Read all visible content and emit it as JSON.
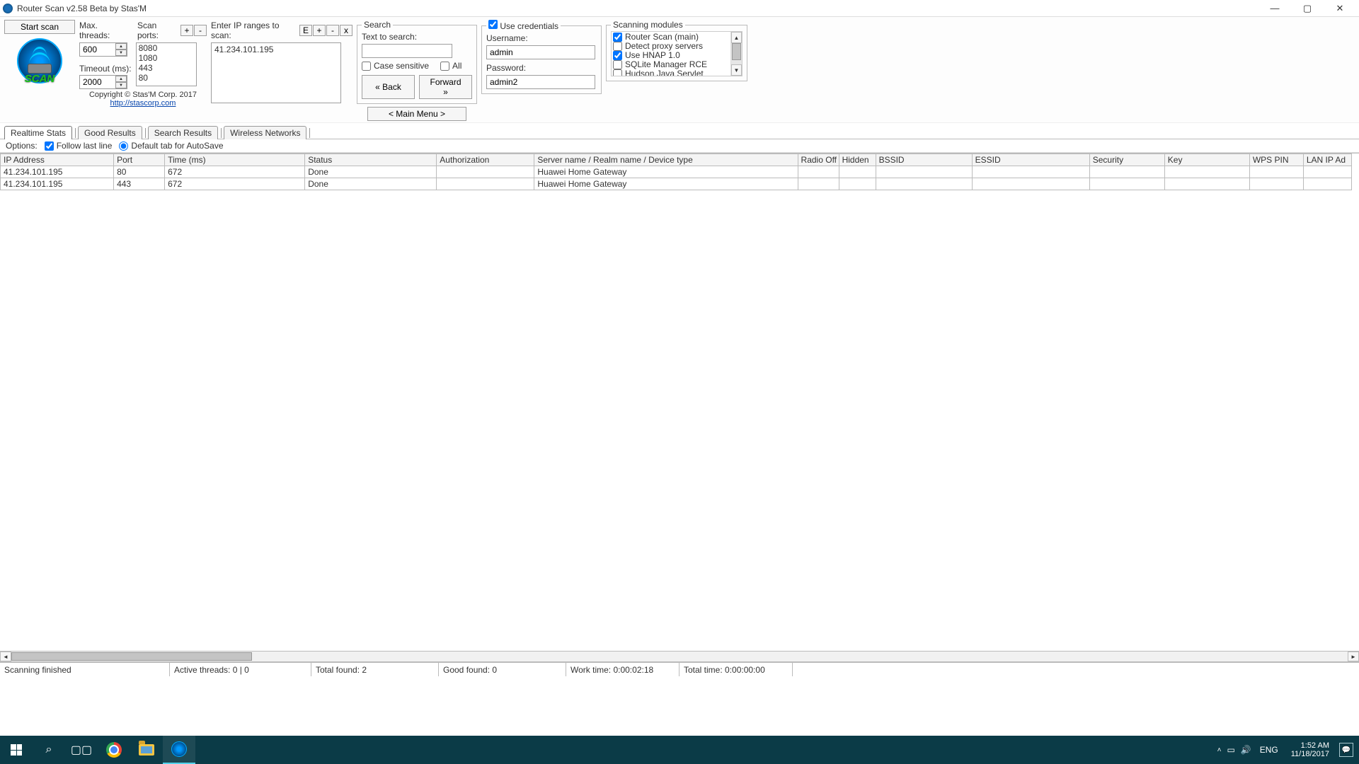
{
  "window": {
    "title": "Router Scan v2.58 Beta by Stas'M",
    "min": "—",
    "max": "▢",
    "close": "✕"
  },
  "buttons": {
    "start_scan": "Start scan",
    "plus": "+",
    "minus": "-",
    "E": "E",
    "x": "x",
    "back": "« Back",
    "forward": "Forward »",
    "main_menu": "< Main Menu >"
  },
  "threads": {
    "max_label": "Max. threads:",
    "scan_ports_label": "Scan ports:",
    "max_value": "600",
    "timeout_label": "Timeout (ms):",
    "timeout_value": "2000",
    "ports": [
      "8080",
      "1080",
      "443",
      "80"
    ]
  },
  "ip": {
    "enter_label": "Enter IP ranges to scan:",
    "value": "41.234.101.195"
  },
  "copyright": {
    "text": "Copyright © Stas'M Corp. 2017",
    "link": "http://stascorp.com"
  },
  "search": {
    "legend": "Search",
    "text_label": "Text to search:",
    "value": "",
    "case_sensitive": "Case sensitive",
    "all": "All",
    "case_checked": false,
    "all_checked": false
  },
  "creds": {
    "use_label": "Use credentials",
    "use_checked": true,
    "user_label": "Username:",
    "user_value": "admin",
    "pass_label": "Password:",
    "pass_value": "admin2"
  },
  "modules": {
    "legend": "Scanning modules",
    "items": [
      {
        "label": "Router Scan (main)",
        "checked": true
      },
      {
        "label": "Detect proxy servers",
        "checked": false
      },
      {
        "label": "Use HNAP 1.0",
        "checked": true
      },
      {
        "label": "SQLite Manager RCE",
        "checked": false
      },
      {
        "label": "Hudson Java Servlet",
        "checked": false
      }
    ]
  },
  "tabs": [
    "Realtime Stats",
    "Good Results",
    "Search Results",
    "Wireless Networks"
  ],
  "options": {
    "label": "Options:",
    "follow_label": "Follow last line",
    "follow_checked": true,
    "default_tab_label": "Default tab for AutoSave",
    "default_tab_selected": true
  },
  "table": {
    "columns": [
      "IP Address",
      "Port",
      "Time (ms)",
      "Status",
      "Authorization",
      "Server name / Realm name / Device type",
      "Radio Off",
      "Hidden",
      "BSSID",
      "ESSID",
      "Security",
      "Key",
      "WPS PIN",
      "LAN IP Ad"
    ],
    "widths": [
      160,
      72,
      198,
      186,
      138,
      372,
      58,
      52,
      136,
      166,
      106,
      120,
      76,
      68
    ],
    "rows": [
      {
        "ip": "41.234.101.195",
        "port": "80",
        "time": "672",
        "status": "Done",
        "auth": "",
        "server": "Huawei Home Gateway",
        "radio": "",
        "hidden": "",
        "bssid": "",
        "essid": "",
        "security": "",
        "key": "",
        "wps": "",
        "lan": ""
      },
      {
        "ip": "41.234.101.195",
        "port": "443",
        "time": "672",
        "status": "Done",
        "auth": "",
        "server": "Huawei Home Gateway",
        "radio": "",
        "hidden": "",
        "bssid": "",
        "essid": "",
        "security": "",
        "key": "",
        "wps": "",
        "lan": ""
      }
    ]
  },
  "status": {
    "scan": "Scanning finished",
    "threads": "Active threads: 0 | 0",
    "total": "Total found: 2",
    "good": "Good found: 0",
    "work": "Work time: 0:00:02:18",
    "totaltime": "Total time: 0:00:00:00"
  },
  "taskbar": {
    "lang": "ENG",
    "time": "1:52 AM",
    "date": "11/18/2017"
  }
}
